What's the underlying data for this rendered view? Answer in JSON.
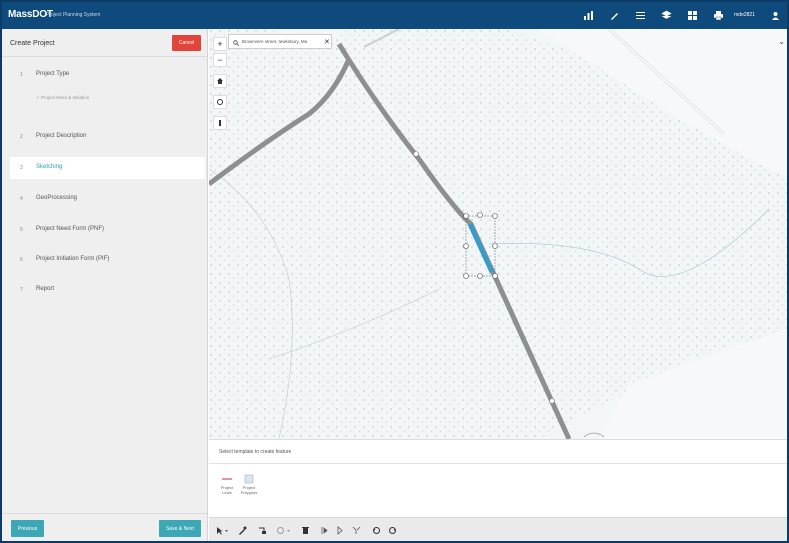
{
  "app": {
    "brand": "MassDOT",
    "subtitle": "Project Planning System",
    "username": "mde2821"
  },
  "colors": {
    "topbar": "#0e4a7c",
    "accent": "#2a9fb8",
    "cancel": "#e0443a",
    "selected_segment": "#3a9cc6"
  },
  "topbar_icons": [
    "chart-icon",
    "pencil-icon",
    "list-icon",
    "layers-icon",
    "grid-icon",
    "print-icon",
    "user-icon"
  ],
  "sidebar": {
    "title": "Create Project",
    "cancel_label": "Cancel",
    "steps": [
      {
        "num": "1",
        "label": "Project Type"
      },
      {
        "num": "2",
        "label": "Project Description"
      },
      {
        "num": "3",
        "label": "Sketching",
        "active": true
      },
      {
        "num": "4",
        "label": "GeoProcessing"
      },
      {
        "num": "5",
        "label": "Project Need Form (PNF)"
      },
      {
        "num": "6",
        "label": "Project Initiation Form (PIF)"
      },
      {
        "num": "7",
        "label": "Report"
      }
    ],
    "substep": "Project Need & Initiation",
    "previous_label": "Previous",
    "save_next_label": "Save & Next"
  },
  "map": {
    "search_value": "Brownvern street, tewksbury, Ma",
    "zoom_in": "+",
    "zoom_out": "−"
  },
  "template_panel": {
    "title": "Select template to create feature",
    "items": [
      {
        "label": "Project Lines",
        "icon": "line-icon"
      },
      {
        "label": "Project Polygons",
        "icon": "polygon-icon"
      }
    ]
  }
}
